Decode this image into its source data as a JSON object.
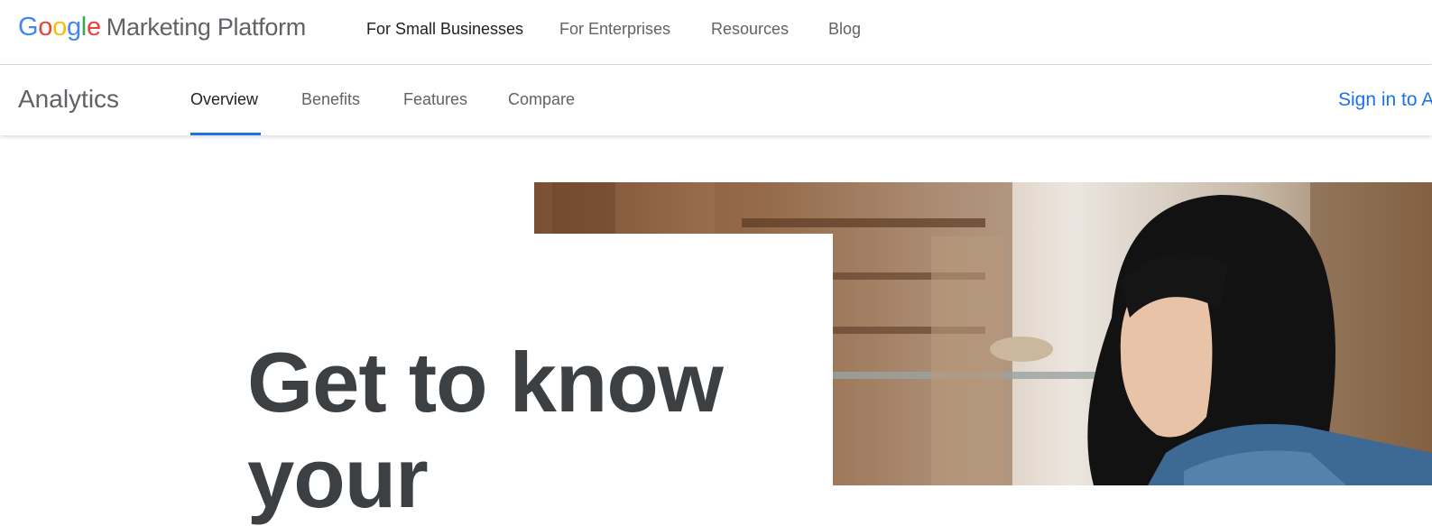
{
  "brand": {
    "google": [
      "G",
      "o",
      "o",
      "g",
      "l",
      "e"
    ],
    "product": "Marketing Platform"
  },
  "top_nav": {
    "items": [
      {
        "label": "For Small Businesses",
        "active": true
      },
      {
        "label": "For Enterprises",
        "active": false
      },
      {
        "label": "Resources",
        "active": false
      },
      {
        "label": "Blog",
        "active": false
      }
    ]
  },
  "sub_nav": {
    "title": "Analytics",
    "tabs": [
      {
        "label": "Overview",
        "active": true
      },
      {
        "label": "Benefits",
        "active": false
      },
      {
        "label": "Features",
        "active": false
      },
      {
        "label": "Compare",
        "active": false
      }
    ],
    "sign_in": "Sign in to A"
  },
  "hero": {
    "headline": "Get to know your"
  },
  "colors": {
    "accent": "#1a73e8",
    "text_dark": "#202124",
    "text_muted": "#5f6368",
    "headline": "#3c4043"
  }
}
